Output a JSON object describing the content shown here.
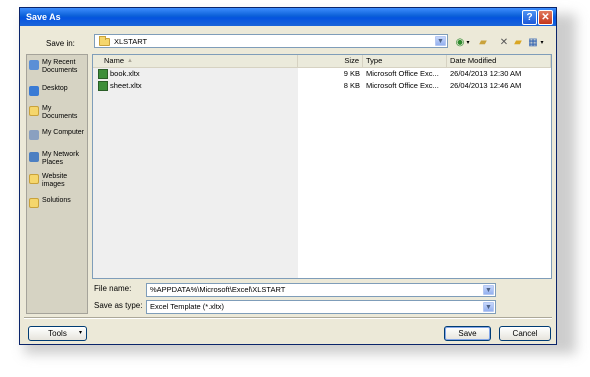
{
  "window": {
    "title": "Save As"
  },
  "title_buttons": {
    "help": "?",
    "close": "✕"
  },
  "save_in": {
    "label": "Save in:",
    "value": "XLSTART"
  },
  "toolbar": {
    "icons": [
      "back-icon",
      "up-folder-icon",
      "delete-icon",
      "new-folder-icon",
      "views-icon"
    ]
  },
  "places": [
    {
      "label": "My Recent Documents",
      "icon": "recent-documents-icon"
    },
    {
      "label": "Desktop",
      "icon": "desktop-icon"
    },
    {
      "label": "My Documents",
      "icon": "my-documents-icon"
    },
    {
      "label": "My Computer",
      "icon": "my-computer-icon"
    },
    {
      "label": "My Network Places",
      "icon": "network-places-icon"
    },
    {
      "label": "Website images",
      "icon": "folder-icon"
    },
    {
      "label": "Solutions",
      "icon": "folder-icon"
    }
  ],
  "columns": {
    "name": "Name",
    "size": "Size",
    "type": "Type",
    "date": "Date Modified"
  },
  "files": [
    {
      "name": "book.xltx",
      "size": "9 KB",
      "type": "Microsoft Office Exc...",
      "date": "26/04/2013 12:30 AM"
    },
    {
      "name": "sheet.xltx",
      "size": "8 KB",
      "type": "Microsoft Office Exc...",
      "date": "26/04/2013 12:46 AM"
    }
  ],
  "file_name": {
    "label": "File name:",
    "value": "%APPDATA%\\Microsoft\\Excel\\XLSTART"
  },
  "save_as_type": {
    "label": "Save as type:",
    "value": "Excel Template (*.xltx)"
  },
  "buttons": {
    "tools": "Tools",
    "save": "Save",
    "cancel": "Cancel"
  }
}
